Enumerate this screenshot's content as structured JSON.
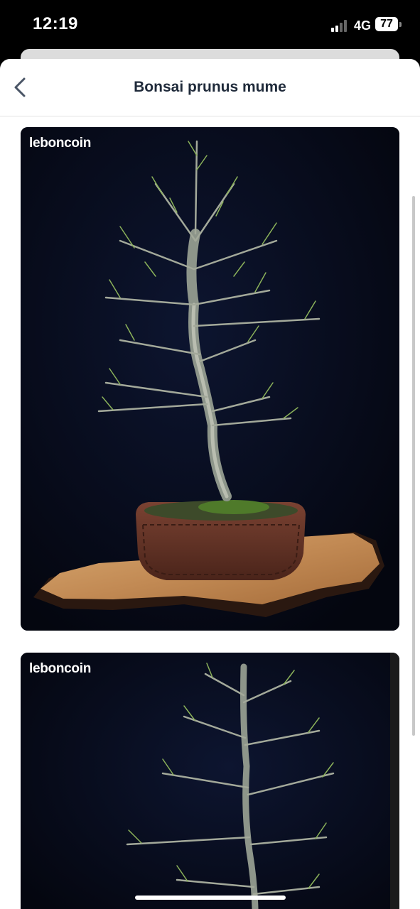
{
  "status_bar": {
    "time": "12:19",
    "network": "4G",
    "battery": "77"
  },
  "header": {
    "back_icon": "chevron-left-icon",
    "title": "Bonsai prunus mume"
  },
  "gallery": {
    "photos": [
      {
        "brand": "leboncoin",
        "subject": "bonsai tree in brown pot on wooden burl slab"
      },
      {
        "brand": "leboncoin",
        "subject": "bonsai tree branches"
      }
    ]
  },
  "colors": {
    "title": "#1f2a3a",
    "photo_background": "#070b1c",
    "pot": "#6e3a2c",
    "burl": "#c99862"
  }
}
